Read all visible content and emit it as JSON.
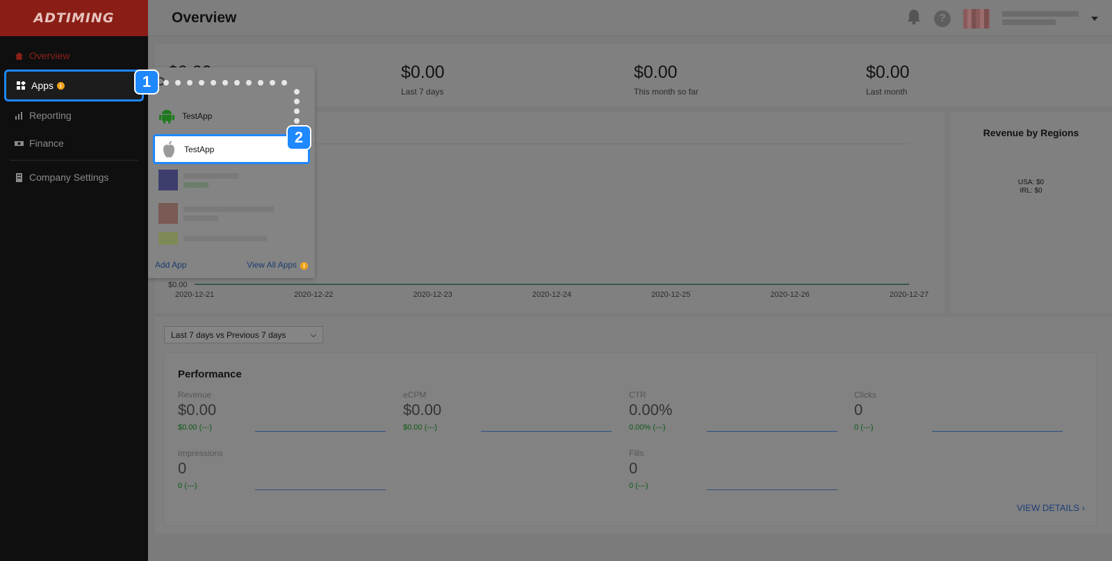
{
  "brand": {
    "name": "ADTIMING"
  },
  "sidebar": {
    "items": [
      {
        "label": "Overview",
        "icon": "home-icon"
      },
      {
        "label": "Apps",
        "icon": "apps-grid-icon"
      },
      {
        "label": "Reporting",
        "icon": "bar-chart-icon"
      },
      {
        "label": "Finance",
        "icon": "money-icon"
      },
      {
        "label": "Company Settings",
        "icon": "building-icon"
      }
    ]
  },
  "header": {
    "title": "Overview"
  },
  "stats": [
    {
      "amount": "$0.00",
      "label": ""
    },
    {
      "amount": "$0.00",
      "label": "Last 7 days"
    },
    {
      "amount": "$0.00",
      "label": "This month so far"
    },
    {
      "amount": "$0.00",
      "label": "Last month"
    }
  ],
  "chart": {
    "y_tick": "$0.00",
    "x_ticks": [
      "2020-12-21",
      "2020-12-22",
      "2020-12-23",
      "2020-12-24",
      "2020-12-25",
      "2020-12-26",
      "2020-12-27"
    ]
  },
  "regions": {
    "title": "Revenue by Regions",
    "entries": [
      "USA: $0",
      "IRL: $0"
    ]
  },
  "compare_select": {
    "value": "Last 7 days vs Previous 7 days"
  },
  "performance": {
    "title": "Performance",
    "metrics": [
      {
        "label": "Revenue",
        "value": "$0.00",
        "change": "$0.00 (---)"
      },
      {
        "label": "eCPM",
        "value": "$0.00",
        "change": "$0.00 (---)"
      },
      {
        "label": "CTR",
        "value": "0.00%",
        "change": "0.00% (---)"
      },
      {
        "label": "Clicks",
        "value": "0",
        "change": "0 (---)"
      },
      {
        "label": "Impressions",
        "value": "0",
        "change": "0 (---)"
      },
      {
        "label": "Fills",
        "value": "0",
        "change": "0 (---)"
      }
    ],
    "view_details": "VIEW DETAILS ›"
  },
  "apps_dropdown": {
    "items": [
      {
        "name": "TestApp",
        "platform": "android-icon"
      },
      {
        "name": "TestApp",
        "platform": "apple-icon"
      }
    ],
    "add_app": "Add App",
    "view_all": "View All Apps"
  },
  "annotations": {
    "step1": "1",
    "step2": "2"
  },
  "colors": {
    "accent": "#1e88ff",
    "brand_red": "#8a1e16",
    "sidebar_bg": "#0f0f0f",
    "warning": "#f0a21a",
    "positive": "#0c5a16"
  }
}
